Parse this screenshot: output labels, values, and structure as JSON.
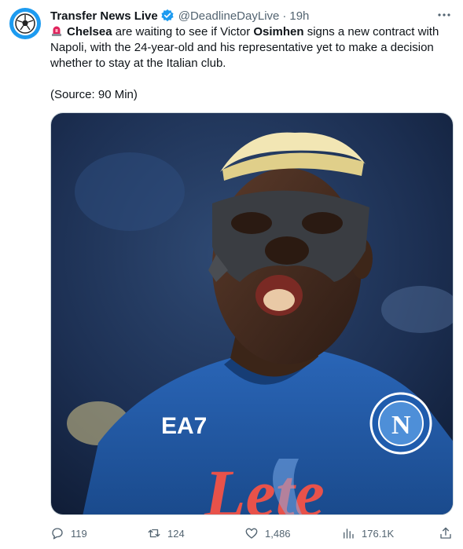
{
  "tweet": {
    "author": {
      "display_name": "Transfer News Live",
      "handle": "@DeadlineDayLive",
      "time": "19h",
      "verified": true
    },
    "text": {
      "part1": "Chelsea",
      "part2": " are waiting to see if Victor ",
      "part3": "Osimhen",
      "part4": " signs a new contract with Napoli, with the 24-year-old and his representative yet to make a decision whether to stay at the Italian club."
    },
    "source": "(Source: 90 Min)",
    "media": {
      "jersey_sponsor": "EA7",
      "badge_letter": "N",
      "shirt_text": "Lete"
    },
    "actions": {
      "replies": "119",
      "retweets": "124",
      "likes": "1,486",
      "views": "176.1K"
    }
  },
  "colors": {
    "accent": "#1d9bf0",
    "text": "#0f1419",
    "muted": "#536471"
  }
}
